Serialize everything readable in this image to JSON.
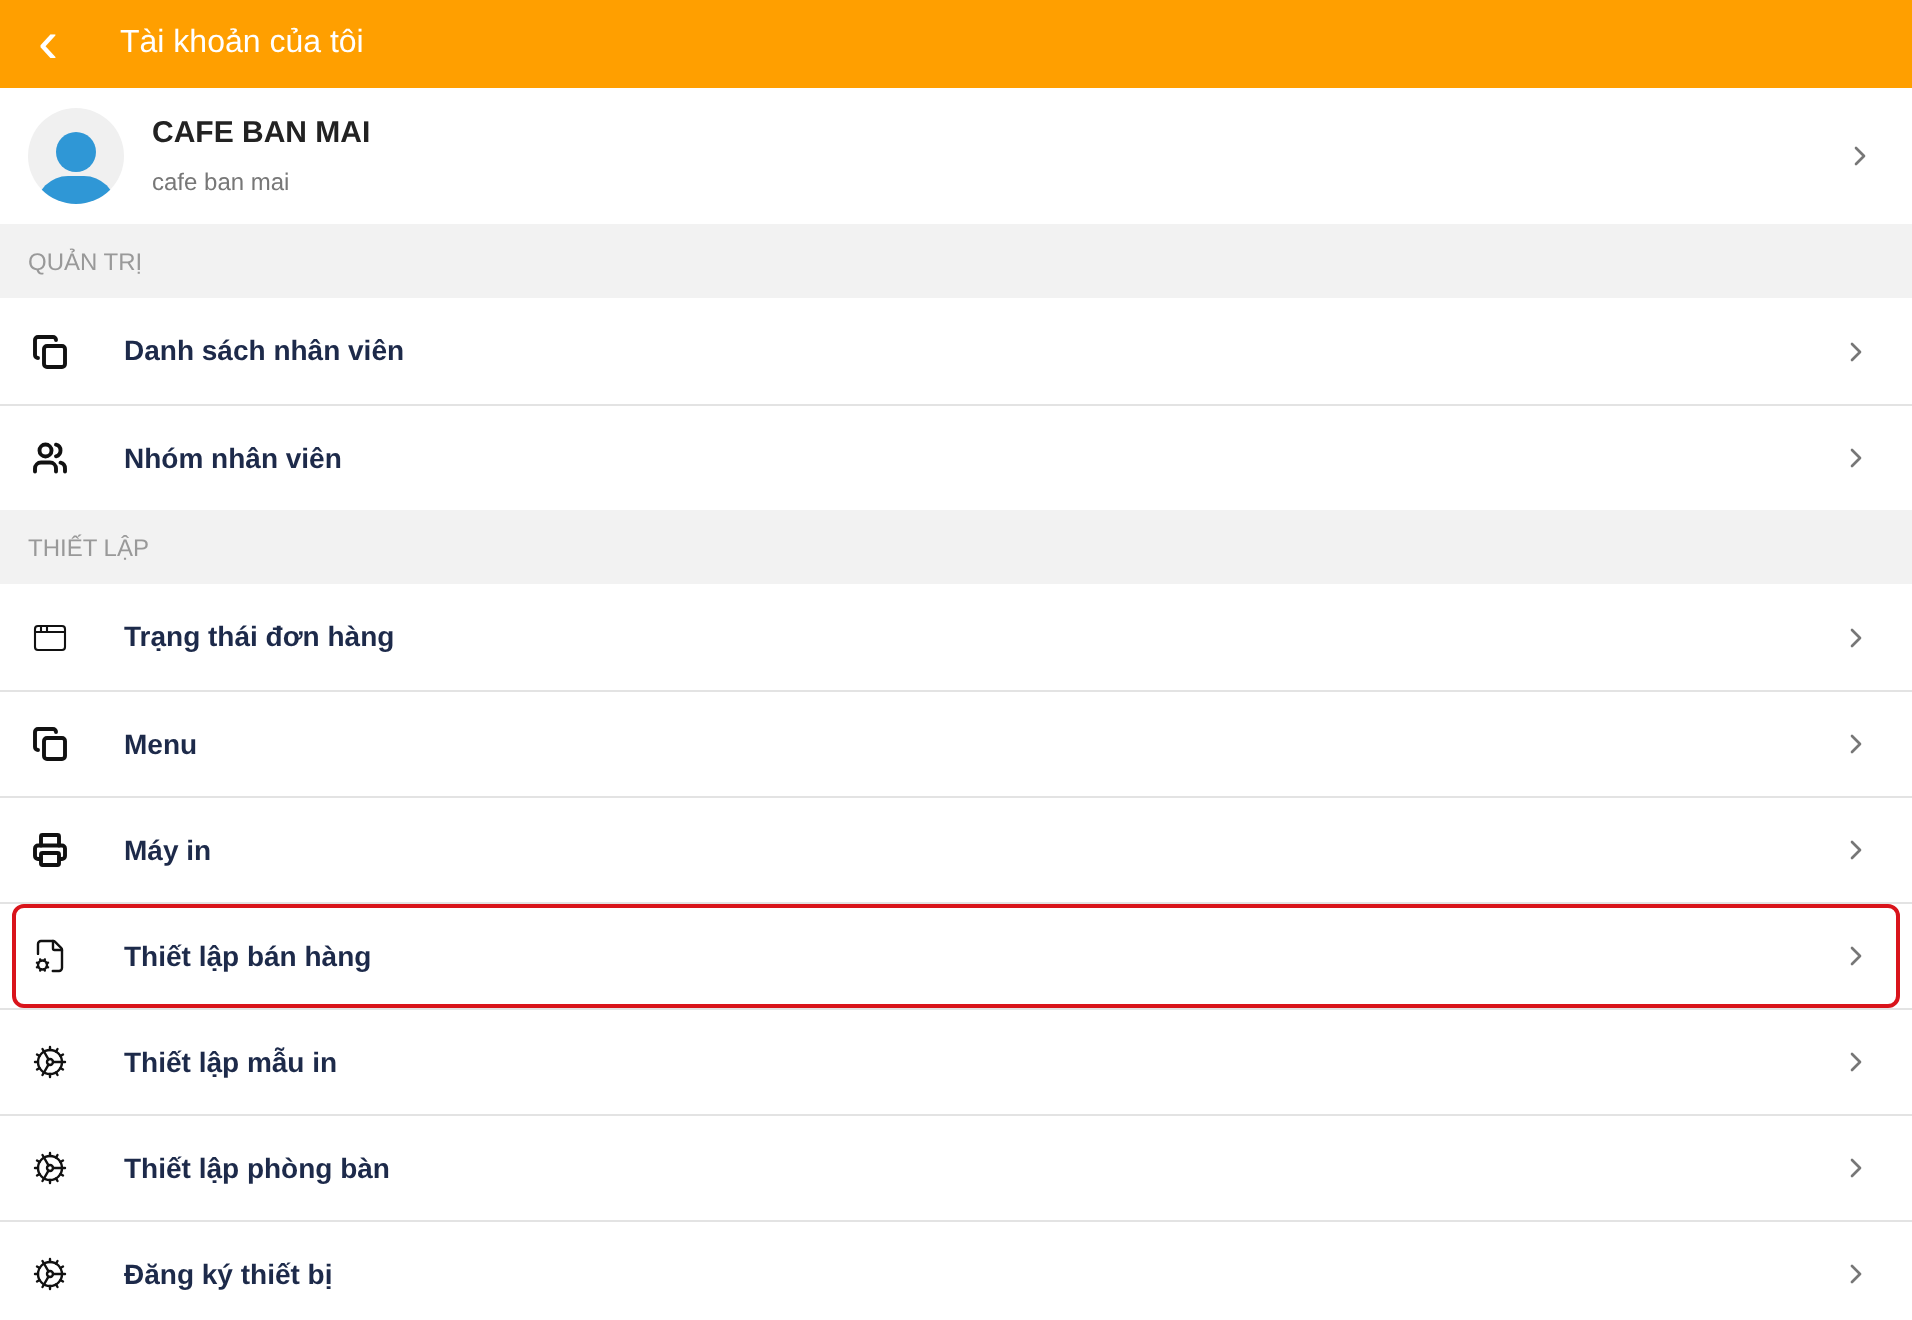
{
  "header": {
    "back": "‹",
    "title": "Tài khoản của tôi"
  },
  "profile": {
    "name": "CAFE BAN MAI",
    "subtitle": "cafe ban mai"
  },
  "sections": [
    {
      "title": "QUẢN TRỊ",
      "items": [
        {
          "label": "Danh sách nhân viên",
          "kind": "documents",
          "highlighted": false
        },
        {
          "label": "Nhóm nhân viên",
          "kind": "people",
          "highlighted": false
        }
      ]
    },
    {
      "title": "THIẾT LẬP",
      "items": [
        {
          "label": "Trạng thái đơn hàng",
          "kind": "window",
          "highlighted": false
        },
        {
          "label": "Menu",
          "kind": "documents",
          "highlighted": false
        },
        {
          "label": "Máy in",
          "kind": "printer",
          "highlighted": false
        },
        {
          "label": "Thiết lập bán hàng",
          "kind": "filegear",
          "highlighted": true
        },
        {
          "label": "Thiết lập mẫu in",
          "kind": "gear",
          "highlighted": false
        },
        {
          "label": "Thiết lập phòng bàn",
          "kind": "gear",
          "highlighted": false
        },
        {
          "label": "Đăng ký thiết bị",
          "kind": "gear",
          "highlighted": false
        }
      ]
    }
  ]
}
